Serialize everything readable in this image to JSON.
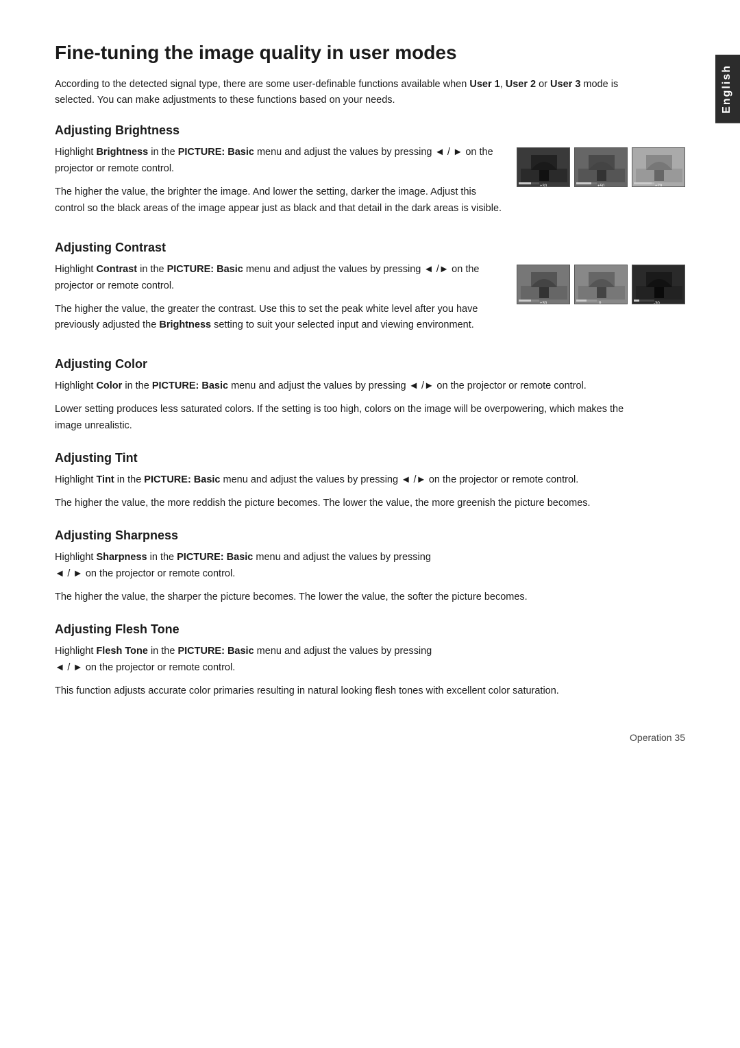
{
  "page": {
    "title": "Fine-tuning the image quality in user modes",
    "side_tab": "English",
    "intro": "According to the detected signal type, there are some user-definable functions available when User 1, User 2 or User 3 mode is selected. You can make adjustments to these functions based on your needs.",
    "sections": [
      {
        "id": "brightness",
        "heading": "Adjusting Brightness",
        "paragraphs": [
          "Highlight Brightness in the PICTURE: Basic menu and adjust the values by pressing ◄ / ► on the projector or remote control.",
          "The higher the value, the brighter the image. And lower the setting, darker the image. Adjust this control so the black areas of the image appear just as black and that detail in the dark areas is visible."
        ],
        "has_images": true,
        "images": [
          {
            "tone": "dark",
            "label": "+30"
          },
          {
            "tone": "mid",
            "label": "+50"
          },
          {
            "tone": "light",
            "label": "+70"
          }
        ]
      },
      {
        "id": "contrast",
        "heading": "Adjusting Contrast",
        "paragraphs": [
          "Highlight Contrast in the PICTURE: Basic menu and adjust the values by pressing ◄ /► on the projector or remote control.",
          "The higher the value, the greater the contrast. Use this to set the peak white level after you have previously adjusted the Brightness setting to suit your selected input and viewing environment."
        ],
        "has_images": true,
        "images": [
          {
            "tone": "mid",
            "label": "+30"
          },
          {
            "tone": "neutral",
            "label": "0"
          },
          {
            "tone": "very-dark",
            "label": "-30"
          }
        ]
      },
      {
        "id": "color",
        "heading": "Adjusting Color",
        "paragraphs": [
          "Highlight Color in the PICTURE: Basic menu and adjust the values by pressing ◄ /► on the projector or remote control.",
          "Lower setting produces less saturated colors. If the setting is too high, colors on the image will be overpowering, which makes the image unrealistic."
        ],
        "has_images": false
      },
      {
        "id": "tint",
        "heading": "Adjusting Tint",
        "paragraphs": [
          "Highlight Tint in the PICTURE: Basic menu and adjust the values by pressing ◄ /► on the projector or remote control.",
          "The higher the value, the more reddish the picture becomes. The lower the value, the more greenish the picture becomes."
        ],
        "has_images": false
      },
      {
        "id": "sharpness",
        "heading": "Adjusting Sharpness",
        "paragraphs": [
          "Highlight Sharpness in the PICTURE: Basic menu and adjust the values by pressing ◄ / ► on the projector or remote control.",
          "The higher the value, the sharper the picture becomes. The lower the value, the softer the picture becomes."
        ],
        "has_images": false
      },
      {
        "id": "flesh-tone",
        "heading": "Adjusting Flesh Tone",
        "paragraphs": [
          "Highlight Flesh Tone in the PICTURE: Basic menu and adjust the values by pressing ◄ / ► on the projector or remote control.",
          "This function adjusts accurate color primaries resulting in natural looking flesh tones with excellent color saturation."
        ],
        "has_images": false
      }
    ],
    "footer": "Operation    35"
  }
}
